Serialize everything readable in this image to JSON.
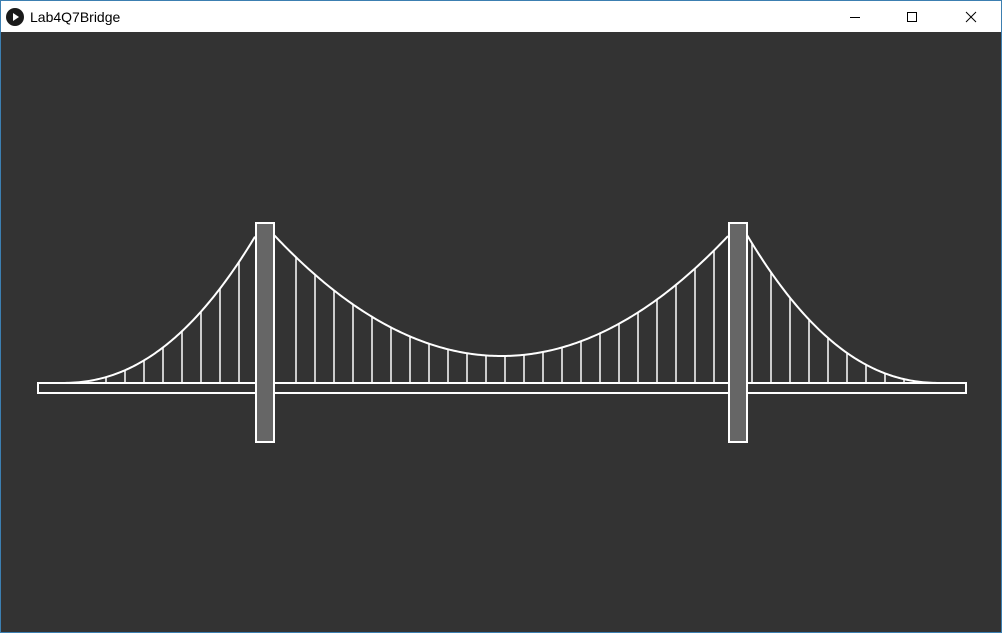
{
  "window": {
    "title": "Lab4Q7Bridge",
    "app_icon": "processing-play-icon",
    "controls": {
      "minimize_icon": "minimize-icon",
      "maximize_icon": "maximize-icon",
      "close_icon": "close-icon"
    }
  },
  "sketch": {
    "background_color": "#333333",
    "stroke_color": "#ffffff",
    "tower_fill_color": "#666666",
    "deck_fill_color": "#333333",
    "tower_count": 2,
    "hanger_count": 44
  }
}
